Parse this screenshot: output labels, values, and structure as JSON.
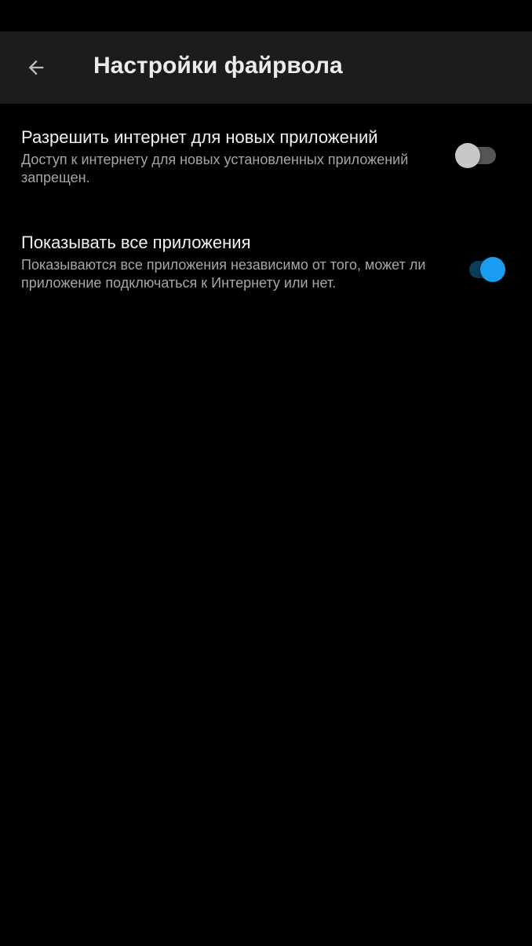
{
  "app_bar": {
    "title": "Настройки файрвола",
    "back_icon": "arrow-back-icon"
  },
  "settings": [
    {
      "title": "Разрешить интернет для новых приложений",
      "summary": "Доступ к интернету для новых установленных приложений запрещен.",
      "enabled": false
    },
    {
      "title": "Показывать все приложения",
      "summary": "Показываются все приложения независимо от того, может ли приложение подключаться к Интернету или нет.",
      "enabled": true
    }
  ],
  "colors": {
    "background": "#000000",
    "app_bar": "#1c1c1c",
    "accent": "#1a9cf0",
    "title_text": "#ececec",
    "summary_text": "#a6a6a6"
  }
}
